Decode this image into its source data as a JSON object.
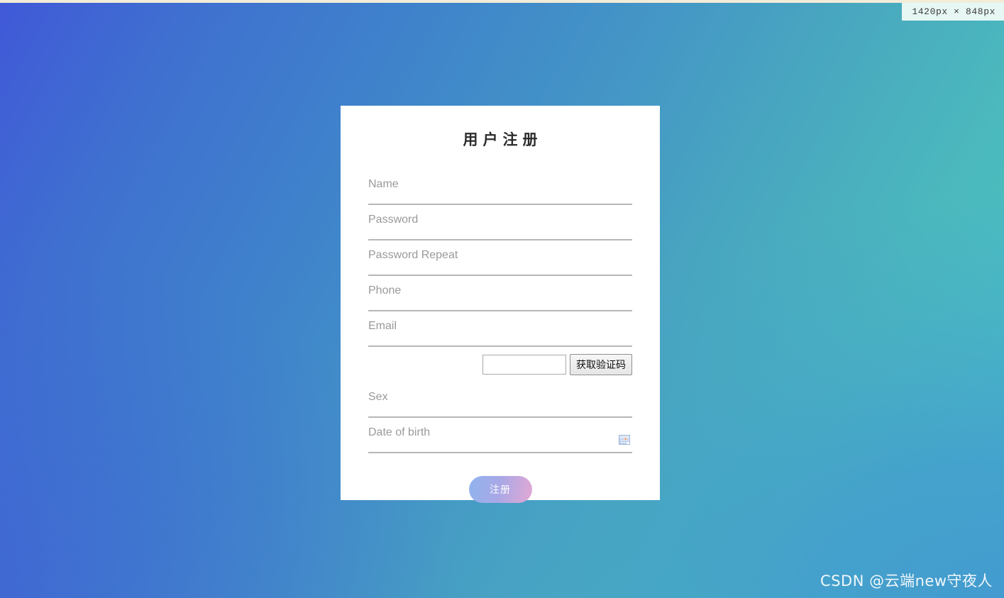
{
  "viewport_badge": {
    "text": "1420px × 848px"
  },
  "card": {
    "title": "用户注册",
    "fields": [
      {
        "name": "name",
        "placeholder": "Name",
        "value": "",
        "type": "text"
      },
      {
        "name": "password",
        "placeholder": "Password",
        "value": "",
        "type": "text"
      },
      {
        "name": "password-repeat",
        "placeholder": "Password Repeat",
        "value": "",
        "type": "text"
      },
      {
        "name": "phone",
        "placeholder": "Phone",
        "value": "",
        "type": "text"
      },
      {
        "name": "email",
        "placeholder": "Email",
        "value": "",
        "type": "text"
      }
    ],
    "captcha": {
      "input_value": "",
      "input_placeholder": "",
      "button_label": "获取验证码"
    },
    "sex": {
      "placeholder": "Sex",
      "value": ""
    },
    "birth": {
      "placeholder": "Date of birth",
      "value": "",
      "icon": "calendar-icon"
    },
    "submit": {
      "label": "注册"
    }
  },
  "watermark": {
    "text": "CSDN @云端new守夜人"
  },
  "colors": {
    "bg_blue_left": "#4059d8",
    "bg_blue_mid": "#3f83cb",
    "bg_teal_right": "#4ac6c6",
    "card_bg": "#ffffff",
    "field_underline": "#b7b7b7",
    "placeholder_text": "#9a9a9a",
    "submit_gradient_start": "#8fb4ee",
    "submit_gradient_end": "#e3a8d4",
    "badge_bg": "#e6f7f4",
    "top_strip": "#f2ecd8"
  }
}
